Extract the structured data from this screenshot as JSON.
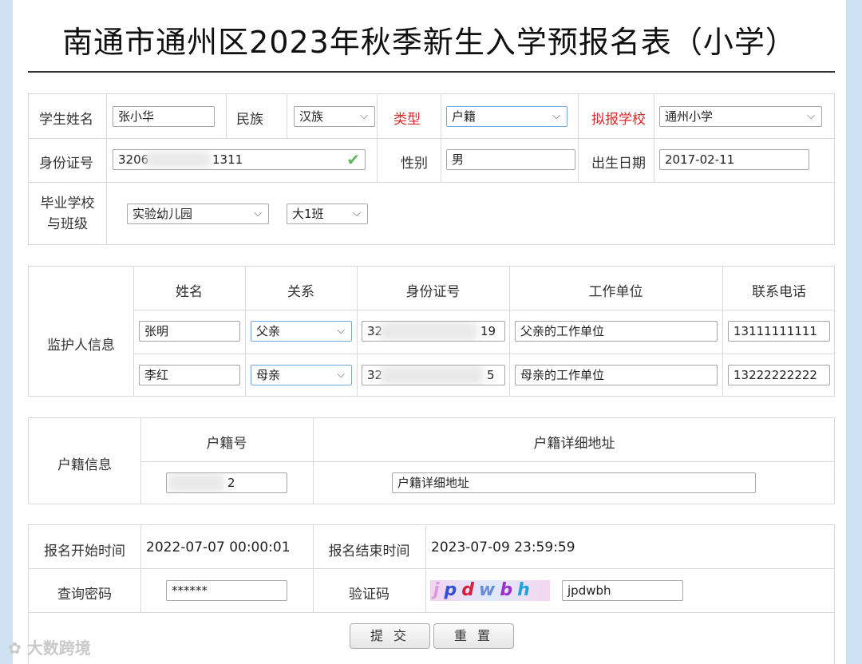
{
  "form_title": "南通市通州区2023年秋季新生入学预报名表（小学）",
  "student": {
    "name_label": "学生姓名",
    "name_value": "张小华",
    "ethnic_label": "民族",
    "ethnic_value": "汉族",
    "type_label": "类型",
    "type_value": "户籍",
    "school_label": "拟报学校",
    "school_value": "通州小学",
    "id_label": "身份证号",
    "id_prefix": "3206",
    "id_suffix": "1311",
    "gender_label": "性别",
    "gender_value": "男",
    "birth_label": "出生日期",
    "birth_value": "2017-02-11",
    "grad_label_1": "毕业学校",
    "grad_label_2": "与班级",
    "grad_school_value": "实验幼儿园",
    "grad_class_value": "大1班"
  },
  "guardians": {
    "section_label": "监护人信息",
    "headers": [
      "姓名",
      "关系",
      "身份证号",
      "工作单位",
      "联系电话"
    ],
    "rows": [
      {
        "name": "张明",
        "relation": "父亲",
        "id_prefix": "32",
        "id_suffix": "19",
        "work": "父亲的工作单位",
        "phone": "13111111111"
      },
      {
        "name": "李红",
        "relation": "母亲",
        "id_prefix": "32",
        "id_suffix": "5",
        "work": "母亲的工作单位",
        "phone": "13222222222"
      }
    ]
  },
  "household": {
    "section_label": "户籍信息",
    "number_header": "户籍号",
    "address_header": "户籍详细地址",
    "number_suffix": "2",
    "address_value": "户籍详细地址"
  },
  "registration": {
    "start_label": "报名开始时间",
    "start_value": "2022-07-07 00:00:01",
    "end_label": "报名结束时间",
    "end_value": "2023-07-09 23:59:59",
    "password_label": "查询密码",
    "password_value": "******",
    "captcha_label": "验证码",
    "captcha_image_text": "jpdwbh",
    "captcha_input": "jpdwbh"
  },
  "buttons": {
    "submit": "提 交",
    "reset": "重 置"
  },
  "watermark": "大数跨境",
  "colors": {
    "required_label": "#e0282b",
    "check": "#5cb85c"
  }
}
